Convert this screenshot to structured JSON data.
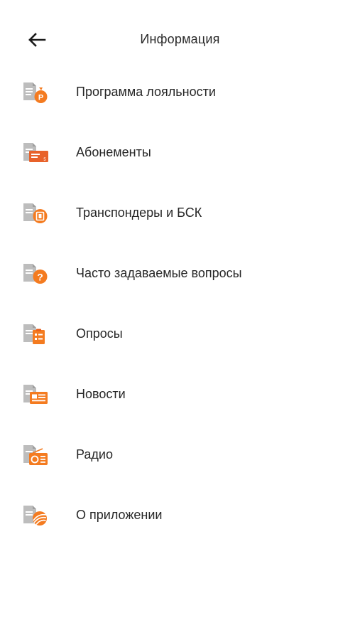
{
  "header": {
    "title": "Информация",
    "back_icon": "arrow-left-icon"
  },
  "colors": {
    "accent": "#F47B20",
    "accent_dark": "#E85D1A",
    "doc_gray": "#B8B8B8"
  },
  "menu": {
    "items": [
      {
        "label": "Программа лояльности",
        "icon": "loyalty-bag-icon"
      },
      {
        "label": "Абонементы",
        "icon": "subscription-ticket-icon"
      },
      {
        "label": "Транспондеры и БСК",
        "icon": "transponder-icon"
      },
      {
        "label": "Часто задаваемые вопросы",
        "icon": "faq-question-icon"
      },
      {
        "label": "Опросы",
        "icon": "survey-clipboard-icon"
      },
      {
        "label": "Новости",
        "icon": "news-newspaper-icon"
      },
      {
        "label": "Радио",
        "icon": "radio-icon"
      },
      {
        "label": "О приложении",
        "icon": "about-app-logo-icon"
      }
    ]
  }
}
